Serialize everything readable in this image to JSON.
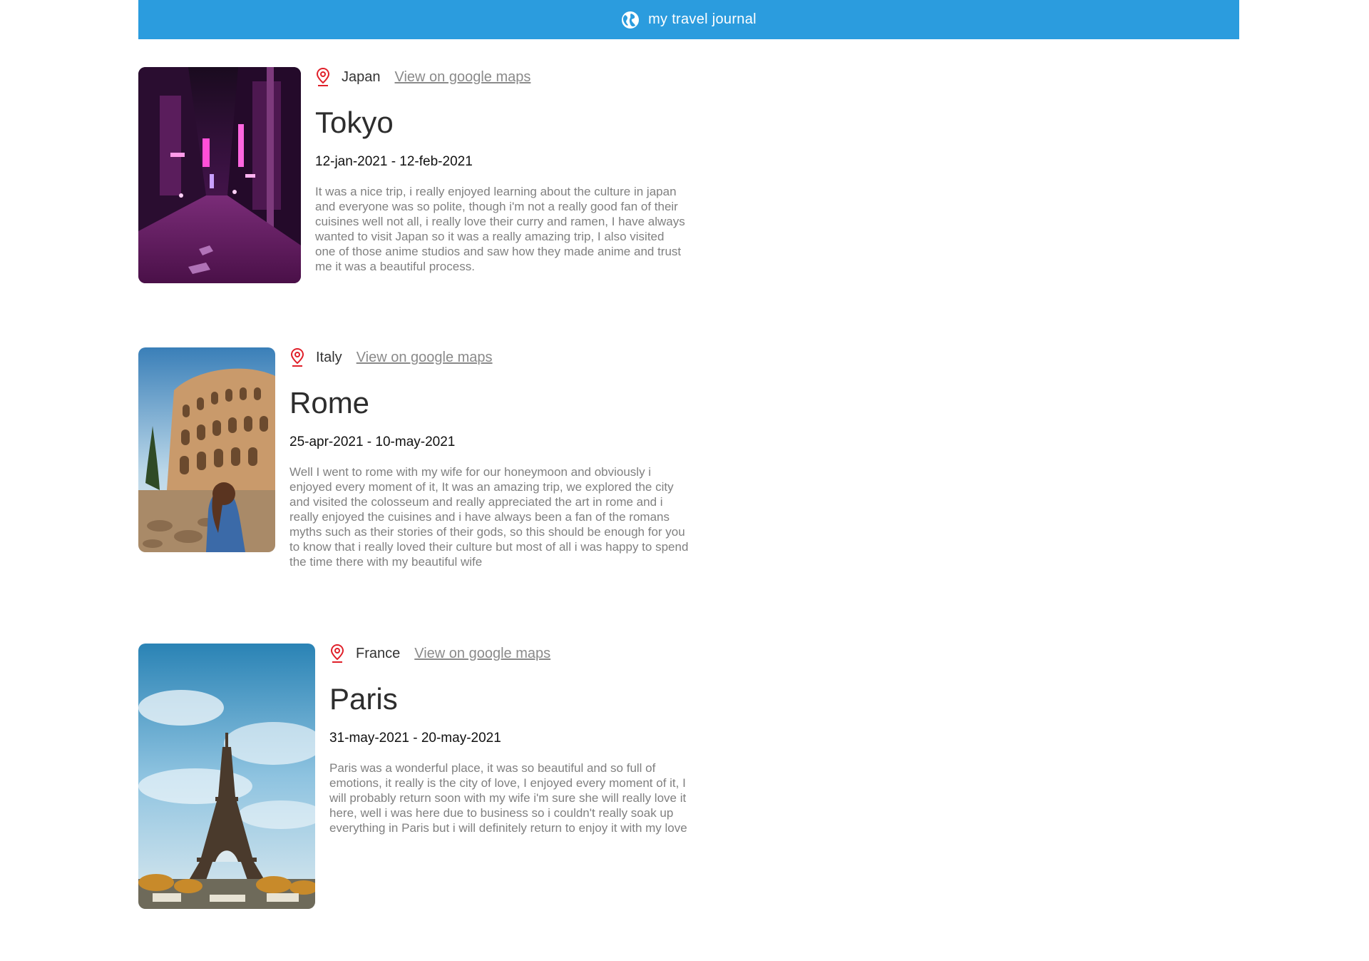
{
  "header": {
    "title": "my travel journal",
    "icon": "globe-icon",
    "bg_color": "#2b9cde"
  },
  "entries": [
    {
      "country": "Japan",
      "maps_link": "View on google maps",
      "city": "Tokyo",
      "dates": "12-jan-2021 - 12-feb-2021",
      "description": "It was a nice trip, i really enjoyed learning about the culture in japan and everyone was so polite, though i'm not a really good fan of their cuisines well not all, i really love their curry and ramen, I have always wanted to visit Japan so it was a really amazing trip, I also visited one of those anime studios and saw how they made anime and trust me it was a beautiful process."
    },
    {
      "country": "Italy",
      "maps_link": "View on google maps",
      "city": "Rome",
      "dates": "25-apr-2021 - 10-may-2021",
      "description": "Well I went to rome with my wife for our honeymoon and obviously i enjoyed every moment of it, It was an amazing trip, we explored the city and visited the colosseum and really appreciated the art in rome and i really enjoyed the cuisines and i have always been a fan of the romans myths such as their stories of their gods, so this should be enough for you to know that i really loved their culture but most of all i was happy to spend the time there with my beautiful wife"
    },
    {
      "country": "France",
      "maps_link": "View on google maps",
      "city": "Paris",
      "dates": "31-may-2021 - 20-may-2021",
      "description": "Paris was a wonderful place, it was so beautiful and so full of emotions, it really is the city of love, I enjoyed every moment of it, I will probably return soon with my wife i'm sure she will really love it here, well i was here due to business so i couldn't really soak up everything in Paris but i will definitely return to enjoy it with my love"
    }
  ],
  "colors": {
    "accent": "#2b9cde",
    "pin": "#e0202a",
    "link": "#8a8a8a",
    "description": "#808080"
  }
}
